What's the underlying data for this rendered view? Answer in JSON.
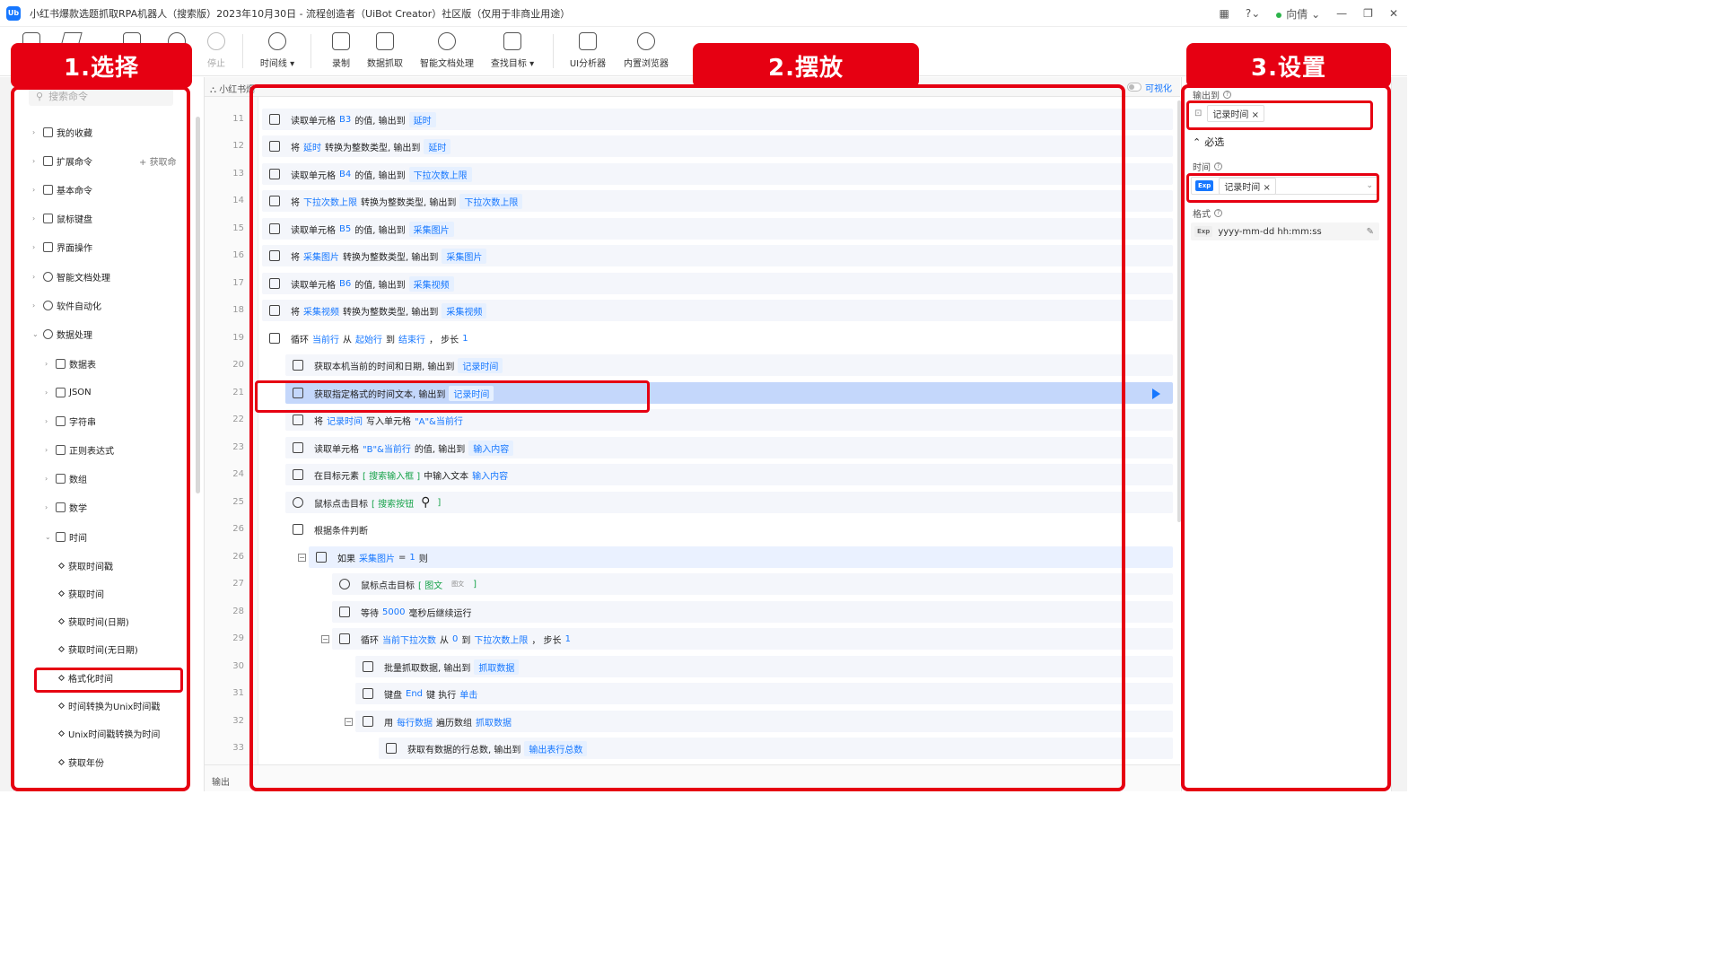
{
  "window": {
    "logo_text": "Ub",
    "title": "小红书爆款选题抓取RPA机器人（搜索版）2023年10月30日 - 流程创造者（UiBot Creator）社区版（仅用于非商业用途）",
    "user": "向倩"
  },
  "toolbar": {
    "stop": "停止",
    "timeline": "时间线",
    "record": "录制",
    "data_scrape": "数据抓取",
    "smart_doc": "智能文档处理",
    "find_target": "查找目标",
    "ui_analyzer": "UI分析器",
    "builtin_browser": "内置浏览器"
  },
  "annotations": {
    "select": "1.选择",
    "place": "2.摆放",
    "settings": "3.设置"
  },
  "left": {
    "search_placeholder": "搜索命令",
    "get_commands": "获取命",
    "groups": [
      {
        "label": "我的收藏"
      },
      {
        "label": "扩展命令"
      },
      {
        "label": "基本命令"
      },
      {
        "label": "鼠标键盘"
      },
      {
        "label": "界面操作"
      },
      {
        "label": "智能文档处理"
      },
      {
        "label": "软件自动化"
      },
      {
        "label": "数据处理"
      }
    ],
    "subgroups": [
      {
        "label": "数据表"
      },
      {
        "label": "JSON"
      },
      {
        "label": "字符串"
      },
      {
        "label": "正则表达式"
      },
      {
        "label": "数组"
      },
      {
        "label": "数学"
      },
      {
        "label": "时间"
      }
    ],
    "time_items": [
      {
        "label": "获取时间戳"
      },
      {
        "label": "获取时间"
      },
      {
        "label": "获取时间(日期)"
      },
      {
        "label": "获取时间(无日期)"
      },
      {
        "label": "格式化时间"
      },
      {
        "label": "时间转换为Unix时间戳"
      },
      {
        "label": "Unix时间戳转换为时间"
      },
      {
        "label": "获取年份"
      }
    ]
  },
  "tabs": {
    "current": "小红书爆",
    "visualize": "可视化"
  },
  "code": {
    "rows": [
      {
        "n": "11",
        "t1": "读取单元格 ",
        "k1": "B3",
        "t2": " 的值, 输出到 ",
        "v1": "延时"
      },
      {
        "n": "12",
        "t1": "将 ",
        "k1": "延时",
        "t2": " 转换为整数类型, 输出到 ",
        "v1": "延时"
      },
      {
        "n": "13",
        "t1": "读取单元格 ",
        "k1": "B4",
        "t2": " 的值, 输出到 ",
        "v1": "下拉次数上限"
      },
      {
        "n": "14",
        "t1": "将 ",
        "k1": "下拉次数上限",
        "t2": " 转换为整数类型, 输出到 ",
        "v1": "下拉次数上限"
      },
      {
        "n": "15",
        "t1": "读取单元格 ",
        "k1": "B5",
        "t2": " 的值, 输出到 ",
        "v1": "采集图片"
      },
      {
        "n": "16",
        "t1": "将 ",
        "k1": "采集图片",
        "t2": " 转换为整数类型, 输出到 ",
        "v1": "采集图片"
      },
      {
        "n": "17",
        "t1": "读取单元格 ",
        "k1": "B6",
        "t2": " 的值, 输出到 ",
        "v1": "采集视频"
      },
      {
        "n": "18",
        "t1": "将 ",
        "k1": "采集视频",
        "t2": " 转换为整数类型, 输出到 ",
        "v1": "采集视频"
      },
      {
        "n": "19",
        "t1": "循环 ",
        "k1": "当前行",
        "t2": " 从 ",
        "k2": "起始行",
        "t3": " 到 ",
        "k3": "结束行",
        "t4": "， 步长 ",
        "k4": "1"
      },
      {
        "n": "20",
        "t1": "获取本机当前的时间和日期, 输出到 ",
        "v1": "记录时间"
      },
      {
        "n": "21",
        "t1": "获取指定格式的时间文本, 输出到 ",
        "v1": "记录时间"
      },
      {
        "n": "22",
        "t1": "将 ",
        "k1": "记录时间",
        "t2": " 写入单元格 ",
        "k2": "\"A\"&当前行"
      },
      {
        "n": "23",
        "t1": "读取单元格 ",
        "k1": "\"B\"&当前行",
        "t2": " 的值, 输出到 ",
        "v1": "输入内容"
      },
      {
        "n": "24",
        "t1": "在目标元素 ",
        "g1": "[ 搜索输入框        ]",
        "t2": " 中输入文本 ",
        "k1": "输入内容"
      },
      {
        "n": "25",
        "t1": "鼠标点击目标 ",
        "g1": "[ 搜索按钮",
        "t2": " ]"
      },
      {
        "n": "26",
        "t1": "根据条件判断"
      },
      {
        "n": "26",
        "t1": "如果 ",
        "k1": "采集图片",
        "t2": " = ",
        "k2": "1",
        "t3": " 则"
      },
      {
        "n": "27",
        "t1": "鼠标点击目标 ",
        "g1": "[ 图文",
        "g2": "图文",
        "t2": " ]"
      },
      {
        "n": "28",
        "t1": "等待 ",
        "k1": "5000",
        "t2": " 毫秒后继续运行"
      },
      {
        "n": "29",
        "t1": "循环 ",
        "k1": "当前下拉次数",
        "t2": " 从 ",
        "k2": "0",
        "t3": " 到 ",
        "k3": "下拉次数上限",
        "t4": "， 步长 ",
        "k4": "1"
      },
      {
        "n": "30",
        "t1": "批量抓取数据, 输出到 ",
        "v1": "抓取数据"
      },
      {
        "n": "31",
        "t1": "键盘 ",
        "k1": "End",
        "t2": " 键 执行 ",
        "k2": "单击"
      },
      {
        "n": "32",
        "t1": "用 ",
        "k1": "每行数据",
        "t2": " 遍历数组 ",
        "k2": "抓取数据"
      },
      {
        "n": "33",
        "t1": "获取有数据的行总数, 输出到 ",
        "v1": "输出表行总数"
      }
    ],
    "output_label": "输出"
  },
  "right": {
    "output_to_label": "输出到",
    "output_to_value": "记录时间",
    "required_label": "必选",
    "time_label": "时间",
    "time_value": "记录时间",
    "format_label": "格式",
    "format_value": "yyyy-mm-dd hh:mm:ss",
    "exp": "Exp"
  },
  "colors": {
    "accent": "#1677ff",
    "annotation_red": "#e60012",
    "selected_row": "#c4d7fb"
  }
}
